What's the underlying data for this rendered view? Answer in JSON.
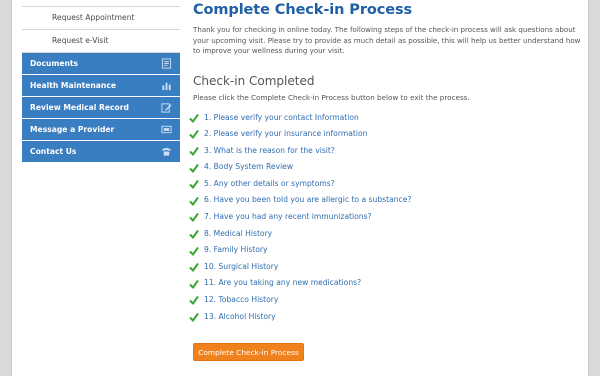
{
  "sidebar": {
    "sub_items": [
      {
        "label": "Request Appointment"
      },
      {
        "label": "Request e-Visit"
      }
    ],
    "nav_items": [
      {
        "label": "Documents",
        "icon": "document-icon"
      },
      {
        "label": "Health Maintenance",
        "icon": "bar-chart-icon"
      },
      {
        "label": "Review Medical Record",
        "icon": "edit-icon"
      },
      {
        "label": "Message a Provider",
        "icon": "message-icon"
      },
      {
        "label": "Contact Us",
        "icon": "phone-icon"
      }
    ],
    "nav_color": "#3a7ec2"
  },
  "main": {
    "title": "Complete Check-in Process",
    "intro": "Thank you for checking in online today. The following steps of the check-in process will ask questions about your upcoming visit. Please try to provide as much detail as possible, this will help us better understand how to improve your wellness during your visit.",
    "section_title": "Check-in Completed",
    "section_sub": "Please click the Complete Check-in Process button below to exit the process.",
    "steps": [
      {
        "label": "1. Please verify your contact Information"
      },
      {
        "label": "2. Please verify your insurance information"
      },
      {
        "label": "3. What is the reason for the visit?"
      },
      {
        "label": "4. Body System Review"
      },
      {
        "label": "5. Any other details or symptoms?"
      },
      {
        "label": "6. Have you been told you are allergic to a substance?"
      },
      {
        "label": "7. Have you had any recent immunizations?"
      },
      {
        "label": "8. Medical History"
      },
      {
        "label": "9. Family History"
      },
      {
        "label": "10. Surgical History"
      },
      {
        "label": "11. Are you taking any new medications?"
      },
      {
        "label": "12. Tobacco History"
      },
      {
        "label": "13. Alcohol History"
      }
    ],
    "complete_button": "Complete Check-in Process",
    "accent_color": "#f0821e",
    "check_color": "#3aa634"
  }
}
